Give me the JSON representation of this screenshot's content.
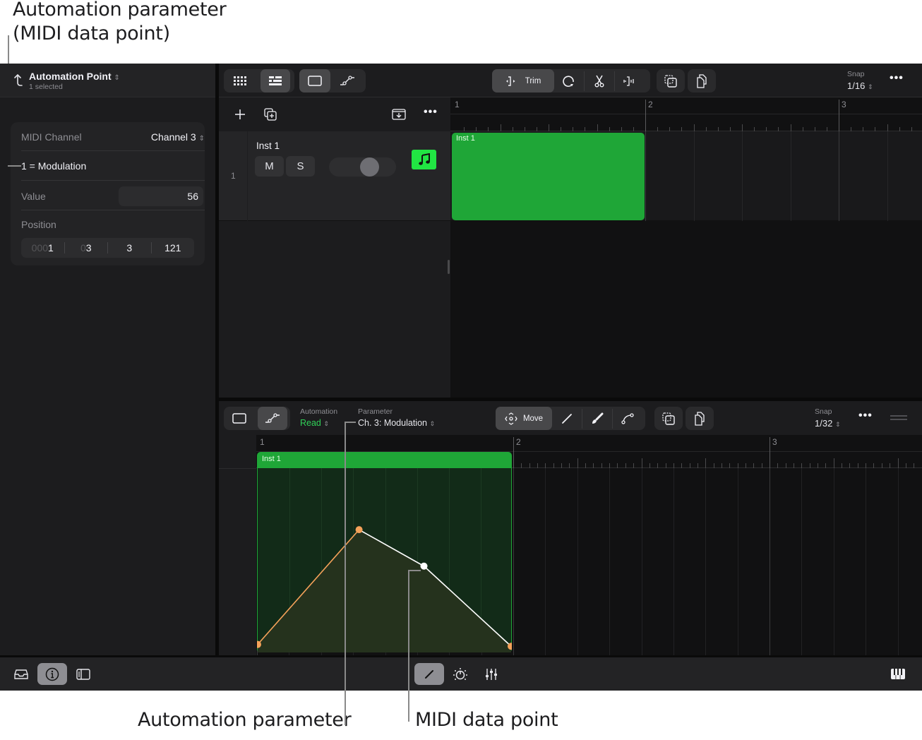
{
  "callouts": {
    "top_left": [
      "Automation parameter",
      "(MIDI data point)"
    ],
    "bottom_automation": "Automation parameter",
    "bottom_point": "MIDI data point"
  },
  "inspector": {
    "title": "Automation Point",
    "subtitle": "1 selected",
    "midi_channel_label": "MIDI Channel",
    "midi_channel_value": "Channel 3",
    "parameter": "1 = Modulation",
    "value_label": "Value",
    "value": "56",
    "position_label": "Position",
    "position": {
      "bar_dim": "000",
      "bar": "1",
      "beat_dim": "0",
      "beat": "3",
      "division": "3",
      "tick": "121"
    }
  },
  "top_toolbar": {
    "trim_label": "Trim",
    "snap_label": "Snap",
    "snap_value": "1/16",
    "more": "•••"
  },
  "track_list": {
    "tracks": [
      {
        "number": "1",
        "name": "Inst 1",
        "mute": "M",
        "solo": "S",
        "volume": 0.65
      }
    ]
  },
  "tracks_area": {
    "bars": [
      "1",
      "2",
      "3"
    ],
    "region_name": "Inst 1"
  },
  "automation_toolbar": {
    "automation_label": "Automation",
    "automation_mode": "Read",
    "parameter_label": "Parameter",
    "parameter_value": "Ch. 3: Modulation",
    "move_label": "Move",
    "snap_label": "Snap",
    "snap_value": "1/32",
    "more": "•••"
  },
  "automation_editor": {
    "bars": [
      "1",
      "2",
      "3"
    ],
    "region_name": "Inst 1",
    "points": [
      {
        "position": 0.0,
        "value": 0.04,
        "selected": false
      },
      {
        "position": 0.4,
        "value": 0.67,
        "selected": false
      },
      {
        "position": 0.656,
        "value": 0.47,
        "selected": true
      },
      {
        "position": 1.0,
        "value": 0.03,
        "selected": false
      }
    ]
  },
  "colors": {
    "region_green": "#1fa637",
    "instrument_green": "#21e543",
    "automation_orange": "#f5a25a",
    "read_green": "#30d158"
  }
}
